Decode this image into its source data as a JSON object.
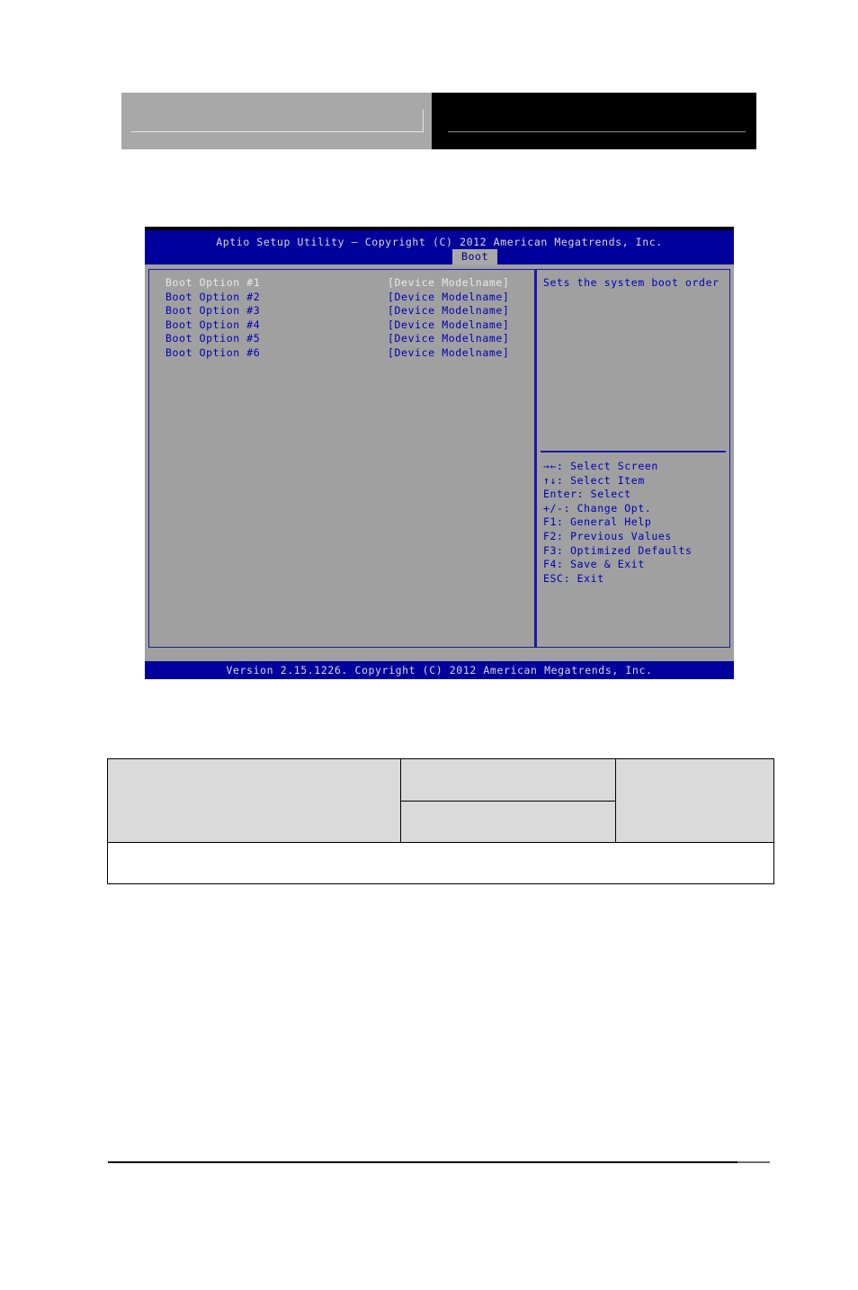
{
  "header": {
    "left_block_color": "#a8a8a8",
    "right_block_color": "#000000",
    "rule_color": "#e6e6e6"
  },
  "bios": {
    "title": "Aptio Setup Utility – Copyright (C) 2012 American Megatrends, Inc.",
    "tabs": [
      {
        "label": "Boot",
        "active": true
      }
    ],
    "boot_options": [
      {
        "label": "Boot Option #1",
        "value": "[Device Modelname]",
        "selected": true
      },
      {
        "label": "Boot Option #2",
        "value": "[Device Modelname]",
        "selected": false
      },
      {
        "label": "Boot Option #3",
        "value": "[Device Modelname]",
        "selected": false
      },
      {
        "label": "Boot Option #4",
        "value": "[Device Modelname]",
        "selected": false
      },
      {
        "label": "Boot Option #5",
        "value": "[Device Modelname]",
        "selected": false
      },
      {
        "label": "Boot Option #6",
        "value": "[Device Modelname]",
        "selected": false
      }
    ],
    "help_text": "Sets the system boot order",
    "key_legend": [
      "→←: Select Screen",
      "↑↓: Select Item",
      "Enter: Select",
      "+/-: Change Opt.",
      "F1: General Help",
      "F2: Previous Values",
      "F3: Optimized Defaults",
      "F4: Save & Exit",
      "ESC: Exit"
    ],
    "version_bar": "Version 2.15.1226. Copyright (C) 2012 American Megatrends, Inc.",
    "colors": {
      "title_bar": "#00009c",
      "body": "#a0a0a0",
      "frame_border": "#1a1aa8",
      "text": "#0000b4",
      "selected_text": "#e9e9e9",
      "tab_active_bg": "#a8a8a8"
    }
  },
  "spec_table": {
    "rows": [
      {
        "cells": [
          {
            "text": "",
            "style": "gray",
            "rowspan": 2,
            "height": "tall"
          },
          {
            "text": "",
            "style": "gray",
            "height": "half"
          },
          {
            "text": "",
            "style": "gray",
            "rowspan": 2,
            "height": "tall"
          }
        ]
      },
      {
        "cells": [
          {
            "text": "",
            "style": "gray",
            "height": "half"
          }
        ]
      },
      {
        "cells": [
          {
            "text": "",
            "style": "white",
            "colspan": 3,
            "height": "note"
          }
        ]
      }
    ]
  },
  "footer": {
    "rule_color": "#000000"
  }
}
